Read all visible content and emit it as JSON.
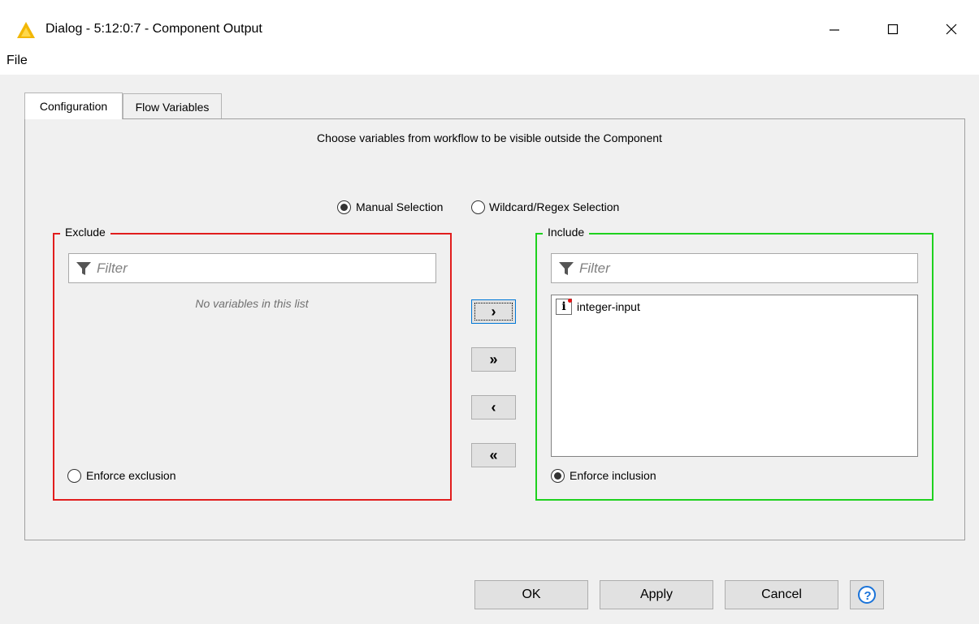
{
  "window": {
    "title": "Dialog - 5:12:0:7 - Component Output",
    "icon": "knime-triangle-icon",
    "controls": {
      "minimize": "—",
      "maximize": "☐",
      "close": "✕"
    }
  },
  "menu": {
    "file": "File"
  },
  "tabs": [
    {
      "label": "Configuration",
      "active": true
    },
    {
      "label": "Flow Variables",
      "active": false
    }
  ],
  "panel": {
    "description": "Choose variables from workflow to be visible outside the Component",
    "selection_mode": {
      "manual": {
        "label": "Manual Selection",
        "selected": true
      },
      "wildcard": {
        "label": "Wildcard/Regex Selection",
        "selected": false
      }
    },
    "exclude": {
      "title": "Exclude",
      "filter_placeholder": "Filter",
      "empty_text": "No variables in this list",
      "enforce_label": "Enforce exclusion",
      "enforce_selected": false,
      "border_color": "#e11d1d"
    },
    "include": {
      "title": "Include",
      "filter_placeholder": "Filter",
      "items": [
        {
          "label": "integer-input",
          "icon": "integer-variable-icon"
        }
      ],
      "enforce_label": "Enforce inclusion",
      "enforce_selected": true,
      "border_color": "#1ed11e"
    },
    "move_buttons": {
      "add": "›",
      "add_all": "»",
      "remove": "‹",
      "remove_all": "«"
    }
  },
  "buttons": {
    "ok": "OK",
    "apply": "Apply",
    "cancel": "Cancel",
    "help": "?"
  }
}
